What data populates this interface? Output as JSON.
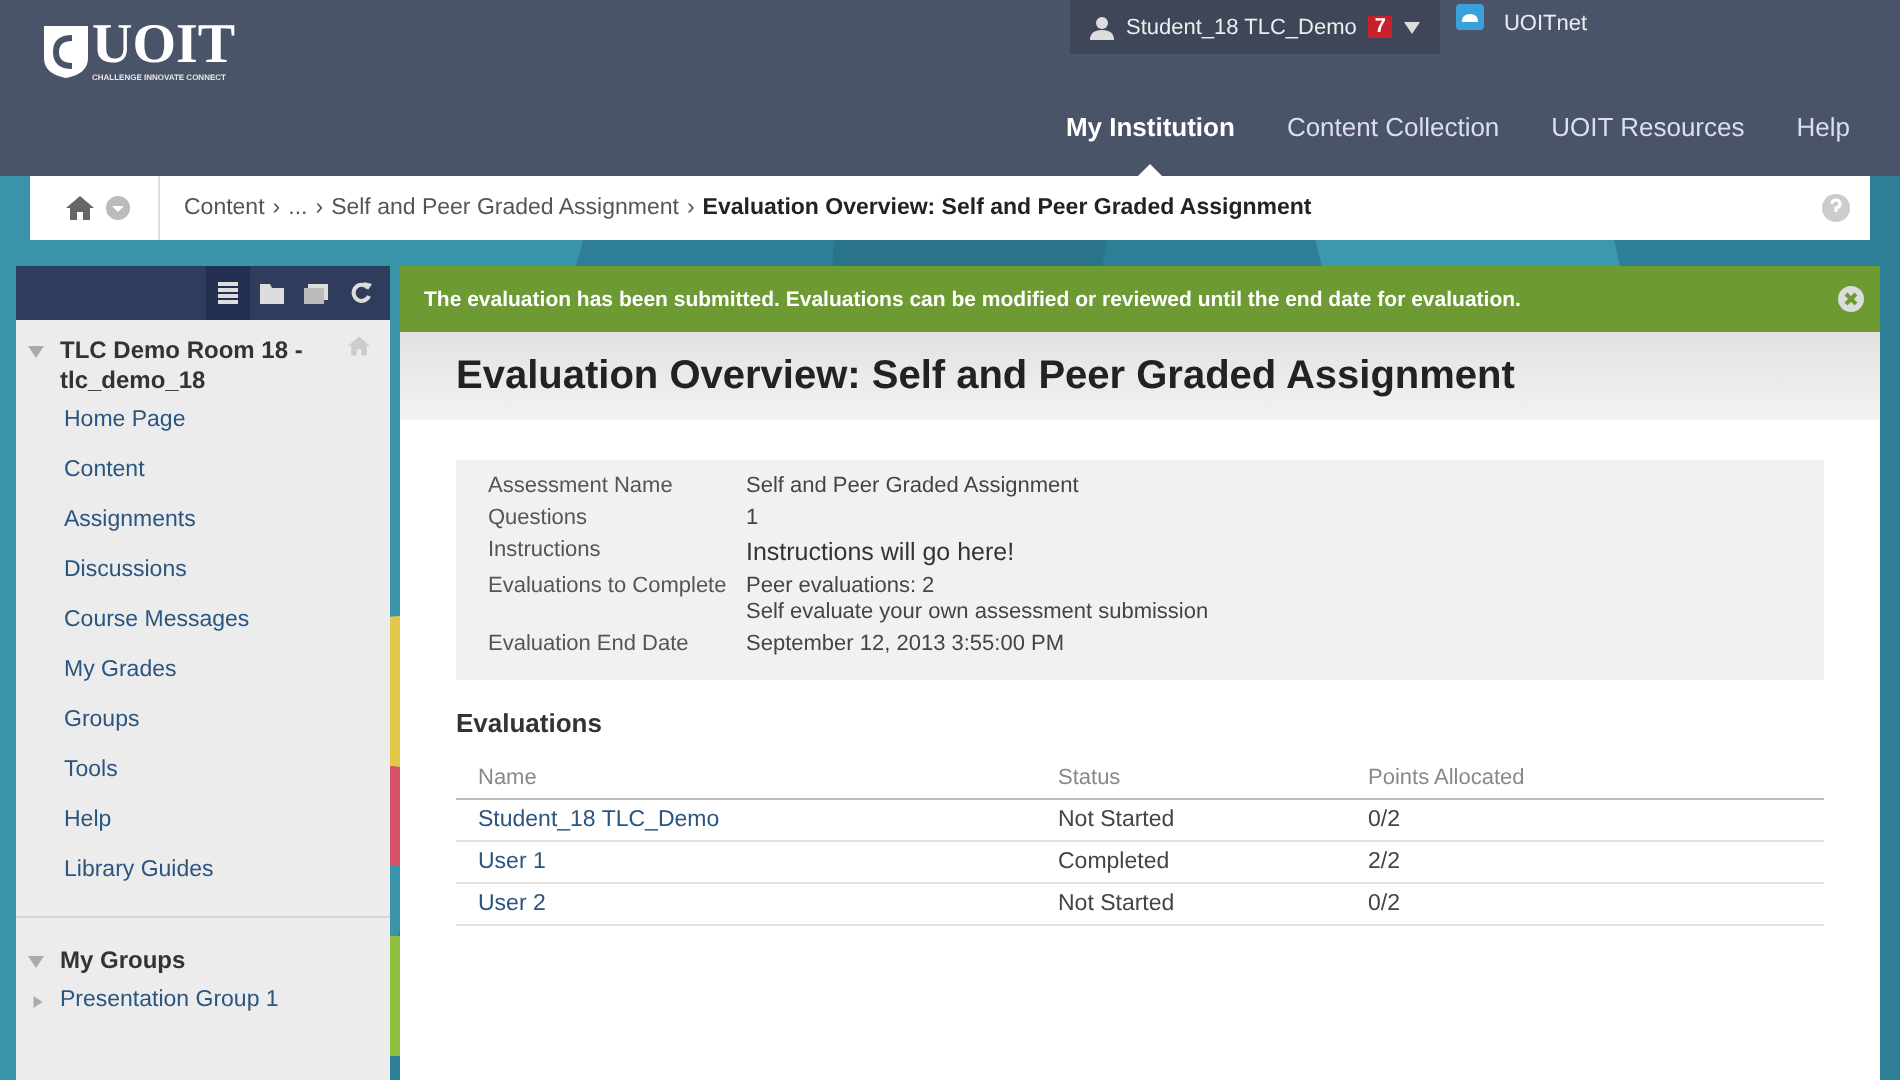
{
  "logo": {
    "text": "UOIT",
    "tagline": "CHALLENGE INNOVATE CONNECT"
  },
  "user_menu": {
    "name": "Student_18 TLC_Demo",
    "badge": "7"
  },
  "portal_link": "UOITnet",
  "nav_tabs": [
    {
      "label": "My Institution",
      "selected": true
    },
    {
      "label": "Content Collection",
      "selected": false
    },
    {
      "label": "UOIT Resources",
      "selected": false
    },
    {
      "label": "Help",
      "selected": false
    }
  ],
  "breadcrumb": {
    "items": [
      "Content",
      "...",
      "Self and Peer Graded Assignment"
    ],
    "current": "Evaluation Overview: Self and Peer Graded Assignment",
    "separator": "›"
  },
  "sidebar": {
    "tools": [
      {
        "kind": "list",
        "selected": true
      },
      {
        "kind": "folder",
        "selected": false
      },
      {
        "kind": "window",
        "selected": false
      },
      {
        "kind": "refresh",
        "selected": false
      }
    ],
    "course": {
      "title": "TLC Demo Room 18 - tlc_demo_18",
      "expanded": true
    },
    "items": [
      "Home Page",
      "Content",
      "Assignments",
      "Discussions",
      "Course Messages",
      "My Grades",
      "Groups",
      "Tools",
      "Help",
      "Library Guides"
    ],
    "groups": {
      "title": "My Groups",
      "expanded": true,
      "items": [
        {
          "label": "Presentation Group 1",
          "expanded": false
        }
      ]
    }
  },
  "banner": "The evaluation has been submitted. Evaluations can be modified or reviewed until the end date for evaluation.",
  "page_title": "Evaluation Overview: Self and Peer Graded Assignment",
  "details": [
    {
      "label": "Assessment Name",
      "values": [
        "Self and Peer Graded Assignment"
      ]
    },
    {
      "label": "Questions",
      "values": [
        "1"
      ]
    },
    {
      "label": "Instructions",
      "values": [
        "Instructions will go here!"
      ],
      "kind": "large"
    },
    {
      "label": "Evaluations to Complete",
      "values": [
        "Peer evaluations: 2",
        "Self evaluate your own assessment submission"
      ]
    },
    {
      "label": "Evaluation End Date",
      "values": [
        "September 12, 2013 3:55:00 PM"
      ]
    }
  ],
  "evaluations": {
    "title": "Evaluations",
    "columns": [
      "Name",
      "Status",
      "Points Allocated"
    ],
    "rows": [
      {
        "name": "Student_18 TLC_Demo",
        "status": "Not Started",
        "points": "0/2"
      },
      {
        "name": "User 1",
        "status": "Completed",
        "points": "2/2"
      },
      {
        "name": "User 2",
        "status": "Not Started",
        "points": "0/2"
      }
    ]
  }
}
